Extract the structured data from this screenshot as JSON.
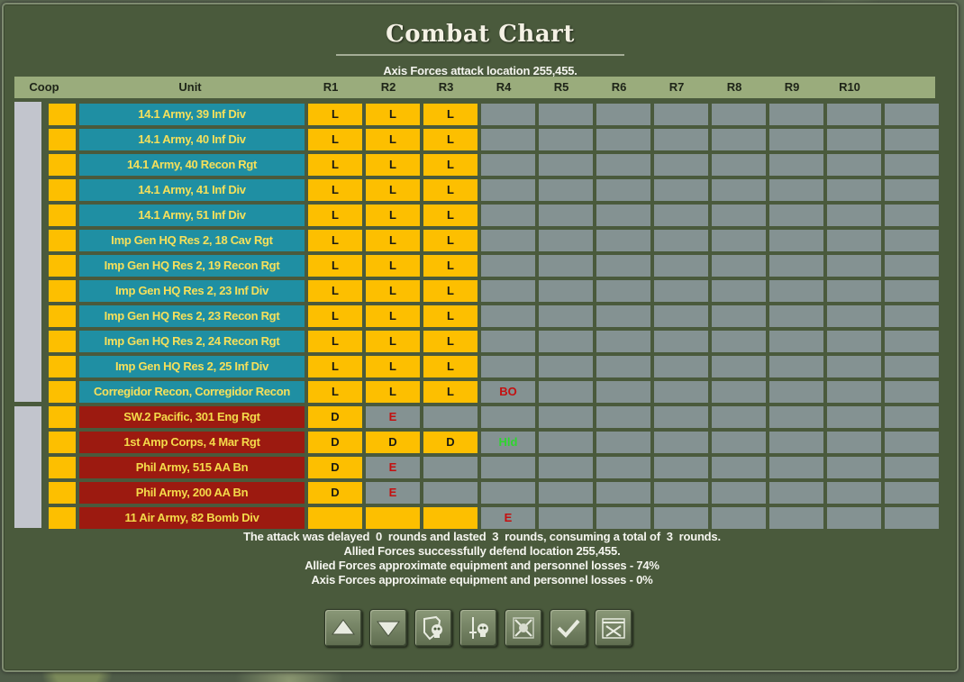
{
  "window": {
    "title": "Combat Chart",
    "subtitle": "Axis Forces attack location 255,455."
  },
  "columns": [
    "Coop",
    "Unit",
    "R1",
    "R2",
    "R3",
    "R4",
    "R5",
    "R6",
    "R7",
    "R8",
    "R9",
    "R10"
  ],
  "units": [
    {
      "side": "axis",
      "name": "14.1 Army, 39 Inf Div",
      "rounds": [
        "L",
        "L",
        "L",
        "",
        "",
        "",
        "",
        "",
        "",
        ""
      ]
    },
    {
      "side": "axis",
      "name": "14.1 Army, 40 Inf Div",
      "rounds": [
        "L",
        "L",
        "L",
        "",
        "",
        "",
        "",
        "",
        "",
        ""
      ]
    },
    {
      "side": "axis",
      "name": "14.1 Army, 40 Recon Rgt",
      "rounds": [
        "L",
        "L",
        "L",
        "",
        "",
        "",
        "",
        "",
        "",
        ""
      ]
    },
    {
      "side": "axis",
      "name": "14.1 Army, 41 Inf Div",
      "rounds": [
        "L",
        "L",
        "L",
        "",
        "",
        "",
        "",
        "",
        "",
        ""
      ]
    },
    {
      "side": "axis",
      "name": "14.1 Army, 51 Inf Div",
      "rounds": [
        "L",
        "L",
        "L",
        "",
        "",
        "",
        "",
        "",
        "",
        ""
      ]
    },
    {
      "side": "axis",
      "name": "Imp Gen HQ Res 2, 18 Cav Rgt",
      "rounds": [
        "L",
        "L",
        "L",
        "",
        "",
        "",
        "",
        "",
        "",
        ""
      ]
    },
    {
      "side": "axis",
      "name": "Imp Gen HQ Res 2, 19 Recon Rgt",
      "rounds": [
        "L",
        "L",
        "L",
        "",
        "",
        "",
        "",
        "",
        "",
        ""
      ]
    },
    {
      "side": "axis",
      "name": "Imp Gen HQ Res 2, 23 Inf Div",
      "rounds": [
        "L",
        "L",
        "L",
        "",
        "",
        "",
        "",
        "",
        "",
        ""
      ]
    },
    {
      "side": "axis",
      "name": "Imp Gen HQ Res 2, 23 Recon Rgt",
      "rounds": [
        "L",
        "L",
        "L",
        "",
        "",
        "",
        "",
        "",
        "",
        ""
      ]
    },
    {
      "side": "axis",
      "name": "Imp Gen HQ Res 2, 24 Recon Rgt",
      "rounds": [
        "L",
        "L",
        "L",
        "",
        "",
        "",
        "",
        "",
        "",
        ""
      ]
    },
    {
      "side": "axis",
      "name": "Imp Gen HQ Res 2, 25 Inf Div",
      "rounds": [
        "L",
        "L",
        "L",
        "",
        "",
        "",
        "",
        "",
        "",
        ""
      ]
    },
    {
      "side": "axis",
      "name": "Corregidor Recon, Corregidor Recon",
      "rounds": [
        "L",
        "L",
        "L",
        "BO",
        "",
        "",
        "",
        "",
        "",
        ""
      ]
    },
    {
      "side": "allied",
      "name": "SW.2 Pacific, 301 Eng Rgt",
      "rounds": [
        "D",
        "E",
        "",
        "",
        "",
        "",
        "",
        "",
        "",
        ""
      ]
    },
    {
      "side": "allied",
      "name": "1st Amp Corps, 4 Mar Rgt",
      "rounds": [
        "D",
        "D",
        "D",
        "Hld",
        "",
        "",
        "",
        "",
        "",
        ""
      ]
    },
    {
      "side": "allied",
      "name": "Phil Army, 515 AA Bn",
      "rounds": [
        "D",
        "E",
        "",
        "",
        "",
        "",
        "",
        "",
        "",
        ""
      ]
    },
    {
      "side": "allied",
      "name": "Phil Army, 200 AA Bn",
      "rounds": [
        "D",
        "E",
        "",
        "",
        "",
        "",
        "",
        "",
        "",
        ""
      ]
    },
    {
      "side": "allied",
      "name": "11 Air Army, 82 Bomb Div",
      "rounds": [
        "",
        "",
        "",
        "E",
        "",
        "",
        "",
        "",
        "",
        ""
      ]
    }
  ],
  "cell_styles": {
    "yellow_rows_r1": [
      0,
      1,
      2,
      3,
      4,
      5,
      6,
      7,
      8,
      9,
      10,
      11,
      12,
      13,
      14,
      15,
      16
    ],
    "note": ""
  },
  "footer": {
    "line1": "The attack was delayed  0  rounds and lasted  3  rounds, consuming a total of  3  rounds.",
    "line2": "Allied Forces successfully defend location 255,455.",
    "line3": "Allied Forces approximate equipment and personnel losses - 74%",
    "line4": "Axis Forces approximate equipment and personnel losses - 0%"
  },
  "buttons": [
    {
      "name": "scroll-up-button",
      "icon": "arrow-up-icon"
    },
    {
      "name": "scroll-down-button",
      "icon": "arrow-down-icon"
    },
    {
      "name": "defender-losses-button",
      "icon": "shield-skull-icon"
    },
    {
      "name": "attacker-losses-button",
      "icon": "sword-skull-icon"
    },
    {
      "name": "cancel-combat-button",
      "icon": "crossed-swords-x-icon"
    },
    {
      "name": "ok-button",
      "icon": "checkmark-icon"
    },
    {
      "name": "combat-chart-button",
      "icon": "chart-swords-icon"
    }
  ],
  "colors": {
    "axis_unit_bg": "#1f8fa3",
    "allied_unit_bg": "#9c1a10",
    "unit_text": "#f6e05a",
    "highlight": "#fdbf00",
    "empty": "#849292",
    "result_red": "#c41010",
    "result_green": "#2fd52f"
  }
}
